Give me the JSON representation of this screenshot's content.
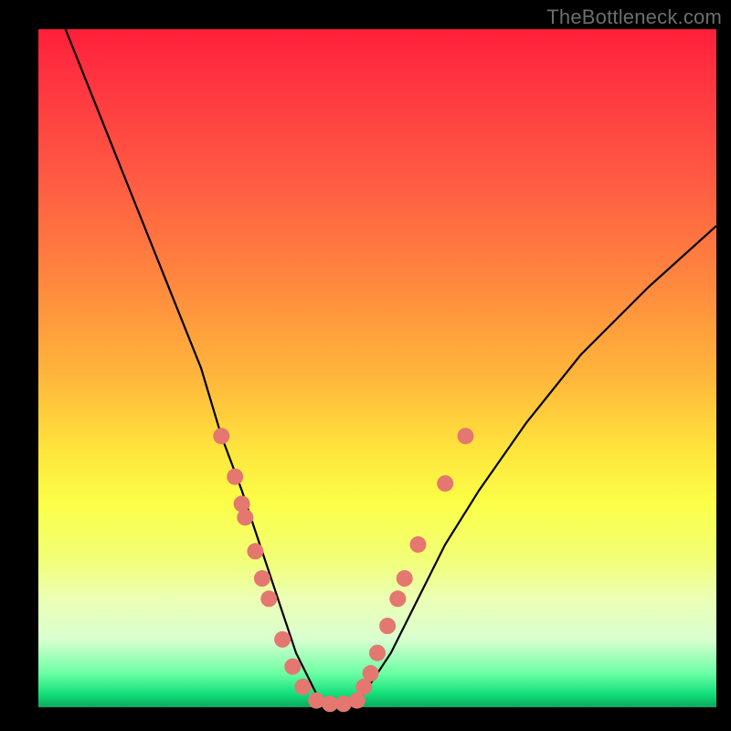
{
  "watermark": "TheBottleneck.com",
  "chart_data": {
    "type": "line",
    "title": "",
    "xlabel": "",
    "ylabel": "",
    "xlim": [
      0,
      100
    ],
    "ylim": [
      0,
      100
    ],
    "series": [
      {
        "name": "bottleneck-curve",
        "x": [
          4,
          8,
          12,
          16,
          20,
          24,
          27,
          30,
          32,
          34,
          36,
          38,
          41,
          44,
          46,
          48,
          52,
          56,
          60,
          65,
          72,
          80,
          90,
          100
        ],
        "values": [
          100,
          90,
          80,
          70,
          60,
          50,
          40,
          32,
          26,
          20,
          14,
          8,
          2,
          0,
          0,
          2,
          8,
          16,
          24,
          32,
          42,
          52,
          62,
          71
        ]
      }
    ],
    "markers": [
      {
        "x": 27,
        "y": 40
      },
      {
        "x": 29,
        "y": 34
      },
      {
        "x": 30,
        "y": 30
      },
      {
        "x": 30.5,
        "y": 28
      },
      {
        "x": 32,
        "y": 23
      },
      {
        "x": 33,
        "y": 19
      },
      {
        "x": 34,
        "y": 16
      },
      {
        "x": 36,
        "y": 10
      },
      {
        "x": 37.5,
        "y": 6
      },
      {
        "x": 39,
        "y": 3
      },
      {
        "x": 41,
        "y": 1
      },
      {
        "x": 43,
        "y": 0.5
      },
      {
        "x": 45,
        "y": 0.5
      },
      {
        "x": 47,
        "y": 1
      },
      {
        "x": 48,
        "y": 3
      },
      {
        "x": 49,
        "y": 5
      },
      {
        "x": 50,
        "y": 8
      },
      {
        "x": 51.5,
        "y": 12
      },
      {
        "x": 53,
        "y": 16
      },
      {
        "x": 54,
        "y": 19
      },
      {
        "x": 56,
        "y": 24
      },
      {
        "x": 60,
        "y": 33
      },
      {
        "x": 63,
        "y": 40
      }
    ],
    "colors": {
      "curve": "#000000",
      "marker": "#e4776f"
    }
  }
}
